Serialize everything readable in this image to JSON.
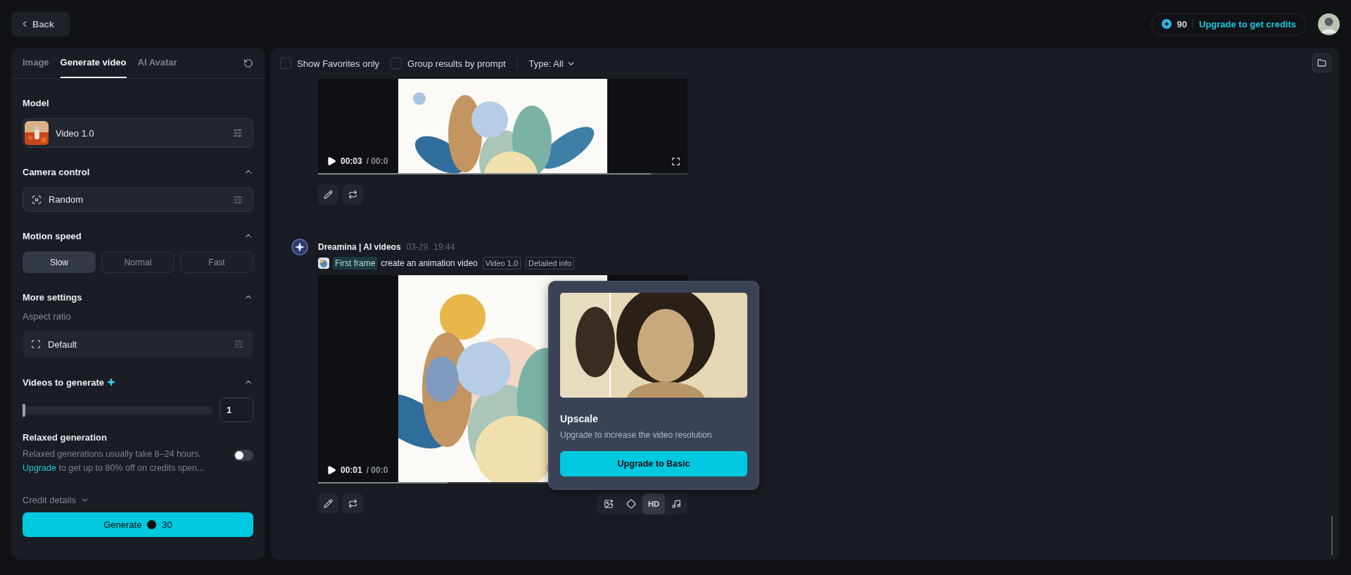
{
  "top_bar": {
    "back_button": "Back",
    "credits": "90",
    "upgrade_link": "Upgrade to get credits"
  },
  "sidebar": {
    "tabs": [
      {
        "label": "Image",
        "selected": false
      },
      {
        "label": "Generate video",
        "selected": true
      },
      {
        "label": "AI Avatar",
        "selected": false
      }
    ],
    "model": {
      "label": "Model",
      "value": "Video 1.0"
    },
    "camera_control": {
      "label": "Camera control",
      "expanded": true,
      "value": "Random"
    },
    "motion_speed": {
      "label": "Motion speed",
      "expanded": true,
      "options": [
        {
          "label": "Slow",
          "selected": true
        },
        {
          "label": "Normal",
          "selected": false
        },
        {
          "label": "Fast",
          "selected": false
        }
      ]
    },
    "more_settings": {
      "label": "More settings",
      "expanded": true,
      "aspect_ratio_label": "Aspect ratio",
      "aspect_ratio": "Default"
    },
    "videos_to_generate": {
      "label": "Videos to generate",
      "expanded": true,
      "level": 0,
      "value": "1"
    },
    "relaxed_generation": {
      "title": "Relaxed generation",
      "description": "Relaxed generations usually take 8–24 hours.",
      "link": "Upgrade",
      "description_rest": "to get up to 80% off on credits spen...",
      "on": false
    },
    "credit_details": "Credit details",
    "generate_button": {
      "label": "Generate",
      "cost": "30"
    }
  },
  "toolbar": {
    "filters": [
      {
        "label": "Show Favorites only",
        "checked": false
      },
      {
        "label": "Group results by prompt",
        "checked": false
      }
    ],
    "type_filter": "Type: All"
  },
  "results": [
    {
      "video": {
        "time": "00:03",
        "duration": "/ 00:0",
        "level": 0.9
      }
    },
    {
      "header": {
        "author": "Dreamina | AI videos",
        "date": "03-29",
        "time": "19:44"
      },
      "prompt": {
        "first_frame": "First frame",
        "text": "create an animation video",
        "tags": [
          "Video 1.0",
          "Detailed info"
        ]
      },
      "video": {
        "time": "00:01",
        "duration": "/ 00:0",
        "level": 0.35
      },
      "tools": [
        {
          "kind": "frame",
          "selected": false
        },
        {
          "kind": "interpolate",
          "selected": false
        },
        {
          "kind": "text",
          "label": "HD",
          "selected": true
        },
        {
          "kind": "music",
          "selected": false
        }
      ]
    }
  ],
  "popover": {
    "title": "Upscale",
    "description": "Upgrade to increase the video resolution",
    "button": "Upgrade to Basic"
  }
}
